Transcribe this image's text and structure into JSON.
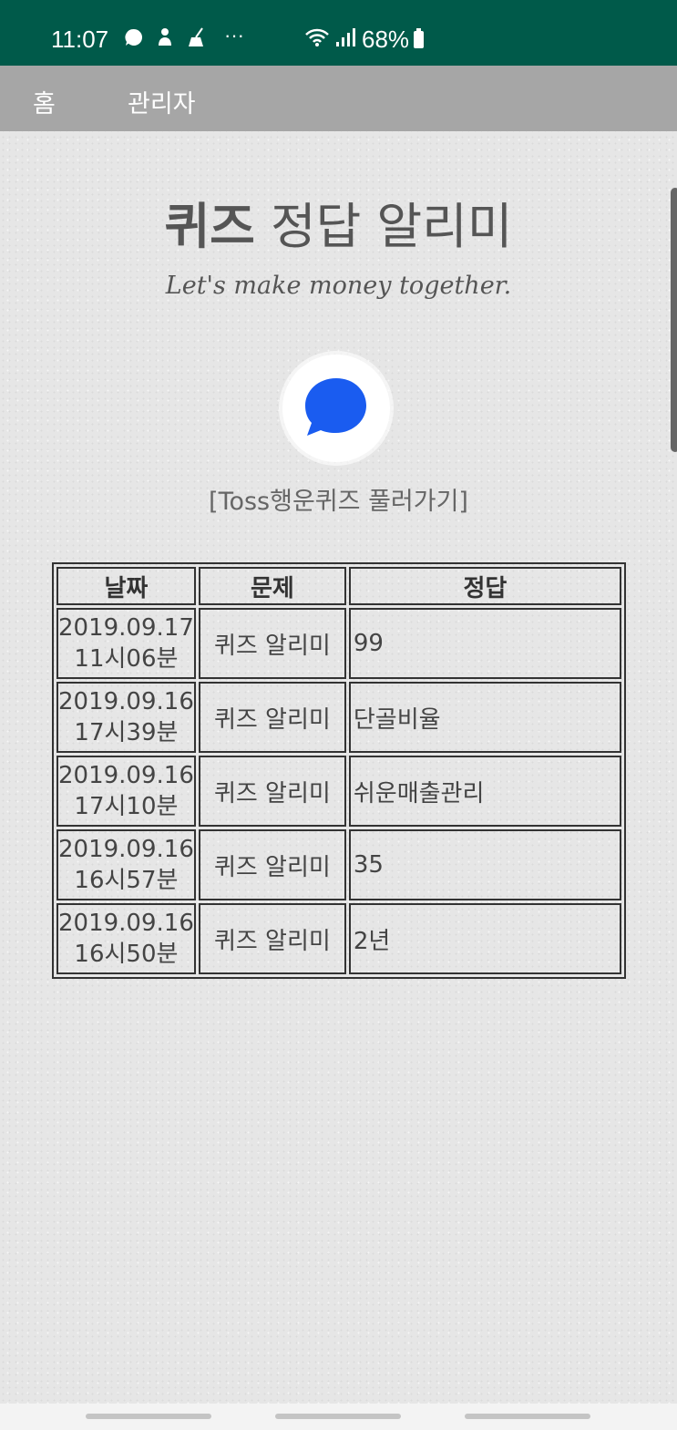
{
  "status_bar": {
    "time": "11:07",
    "icons": [
      "chat-icon",
      "person-icon",
      "broom-icon",
      "more-dots-icon",
      "wifi-icon",
      "signal-icon"
    ],
    "more": "···",
    "battery": "68%"
  },
  "nav": {
    "home": "홈",
    "admin": "관리자"
  },
  "header": {
    "title_bold": "퀴즈",
    "title_rest": " 정답 알리미",
    "subtitle": "Let's make money together."
  },
  "logo": {
    "icon": "toss-logo-icon",
    "color": "#1a5cf0"
  },
  "toss_link": "[Toss행운퀴즈 풀러가기]",
  "table": {
    "headers": [
      "날짜",
      "문제",
      "정답"
    ],
    "rows": [
      {
        "date": "2019.09.17",
        "time": "11시06분",
        "question": "퀴즈 알리미",
        "answer": "99"
      },
      {
        "date": "2019.09.16",
        "time": "17시39분",
        "question": "퀴즈 알리미",
        "answer": "단골비율"
      },
      {
        "date": "2019.09.16",
        "time": "17시10분",
        "question": "퀴즈 알리미",
        "answer": "쉬운매출관리"
      },
      {
        "date": "2019.09.16",
        "time": "16시57분",
        "question": "퀴즈 알리미",
        "answer": "35"
      },
      {
        "date": "2019.09.16",
        "time": "16시50분",
        "question": "퀴즈 알리미",
        "answer": "2년"
      }
    ]
  },
  "colors": {
    "status_bar": "#005a4a",
    "nav_bar": "#a6a6a6",
    "accent": "#1a5cf0"
  }
}
